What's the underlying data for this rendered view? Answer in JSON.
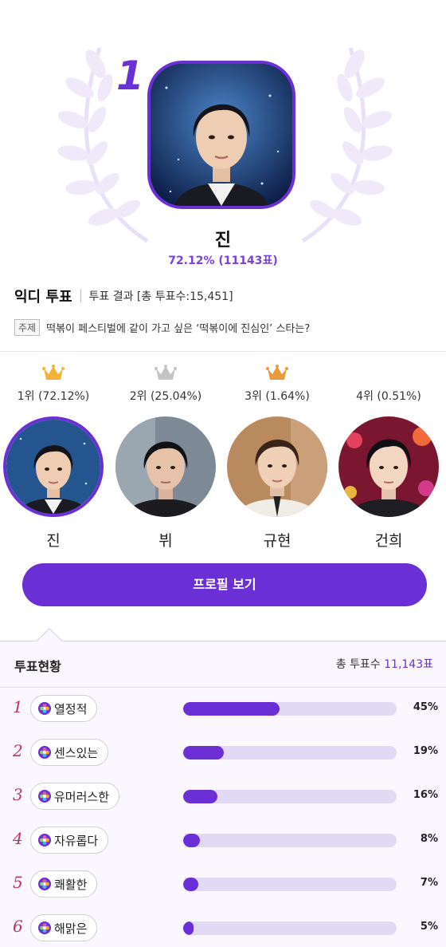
{
  "winner": {
    "rank": "1",
    "name": "진",
    "score": "72.12% (11143표)"
  },
  "vote": {
    "title": "익디 투표",
    "result_label": "투표 결과 [총 투표수:15,451]",
    "topic_tag": "주제",
    "topic": "떡볶이 페스티벌에 같이 가고 싶은 ‘떡볶이에 진심인’ 스타는?"
  },
  "ranking": [
    {
      "rank_label": "1위 (72.12%)",
      "name": "진",
      "crown": "gold-crown-icon",
      "crown_color": "#f5b335"
    },
    {
      "rank_label": "2위 (25.04%)",
      "name": "뷔",
      "crown": "silver-crown-icon",
      "crown_color": "#c4c4c4"
    },
    {
      "rank_label": "3위 (1.64%)",
      "name": "규현",
      "crown": "bronze-crown-icon",
      "crown_color": "#e89a3c"
    },
    {
      "rank_label": "4위 (0.51%)",
      "name": "건희"
    }
  ],
  "profile_button": "프로필 보기",
  "status": {
    "title": "투표현황",
    "total_label": "총 투표수",
    "total_value": "11,143표",
    "traits": [
      {
        "rank": "1",
        "label": "열정적",
        "percent": "45%",
        "value": 45
      },
      {
        "rank": "2",
        "label": "센스있는",
        "percent": "19%",
        "value": 19
      },
      {
        "rank": "3",
        "label": "유머러스한",
        "percent": "16%",
        "value": 16
      },
      {
        "rank": "4",
        "label": "자유롭다",
        "percent": "8%",
        "value": 8
      },
      {
        "rank": "5",
        "label": "쾌활한",
        "percent": "7%",
        "value": 7
      },
      {
        "rank": "6",
        "label": "해맑은",
        "percent": "5%",
        "value": 5
      }
    ]
  },
  "colors": {
    "accent": "#6b2fd6",
    "accent_light": "#e2d9f5",
    "rank_number": "#c0306a"
  }
}
